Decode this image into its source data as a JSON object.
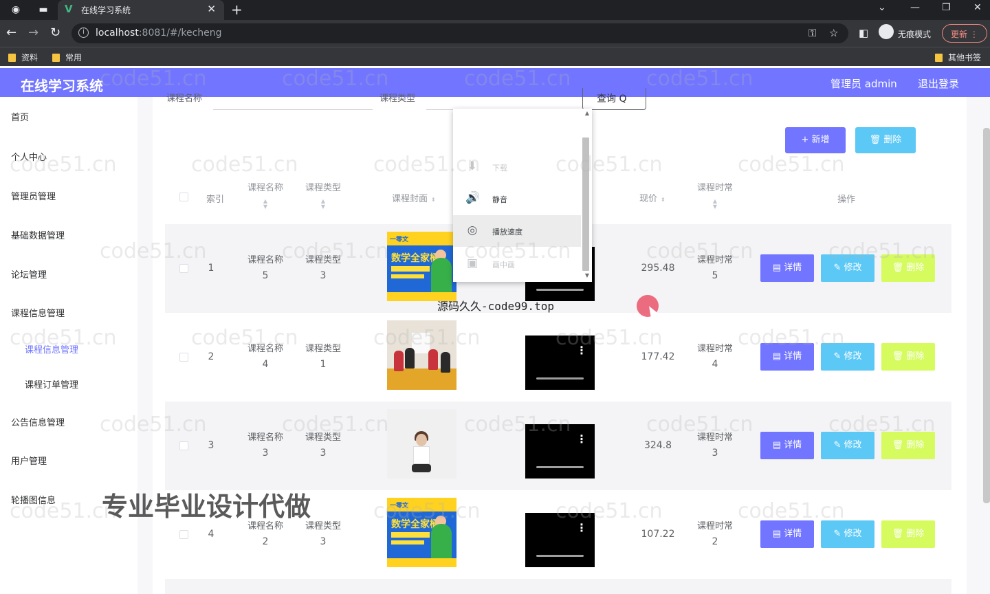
{
  "browser": {
    "tab_title": "在线学习系统",
    "url_host": "localhost",
    "url_rest": ":8081/#/kecheng",
    "incognito_label": "无痕模式",
    "update_label": "更新",
    "bookmarks": [
      "资料",
      "常用"
    ],
    "other_bookmarks": "其他书签"
  },
  "header": {
    "title": "在线学习系统",
    "user": "管理员 admin",
    "logout": "退出登录"
  },
  "sidebar": {
    "items": [
      {
        "label": "首页"
      },
      {
        "label": "个人中心"
      },
      {
        "label": "管理员管理"
      },
      {
        "label": "基础数据管理"
      },
      {
        "label": "论坛管理"
      },
      {
        "label": "课程信息管理"
      },
      {
        "label": "课程信息管理"
      },
      {
        "label": "课程订单管理"
      },
      {
        "label": "公告信息管理"
      },
      {
        "label": "用户管理"
      },
      {
        "label": "轮播图信息"
      }
    ]
  },
  "search": {
    "name_label": "课程名称",
    "type_label": "课程类型",
    "query_label": "查询 Q"
  },
  "toolbar": {
    "add_label": "+ 新增",
    "delete_label": "删除"
  },
  "table": {
    "headers": {
      "index": "索引",
      "name": "课程名称",
      "type": "课程类型",
      "cover": "课程封面",
      "price": "现价",
      "duration": "课程时常",
      "ops": "操作"
    },
    "rows": [
      {
        "index": "1",
        "name_label": "课程名称",
        "name_val": "5",
        "type_label": "课程类型",
        "type_val": "3",
        "price": "295.48",
        "dur_label": "课程时常",
        "dur_val": "5"
      },
      {
        "index": "2",
        "name_label": "课程名称",
        "name_val": "4",
        "type_label": "课程类型",
        "type_val": "1",
        "price": "177.42",
        "dur_label": "课程时常",
        "dur_val": "4"
      },
      {
        "index": "3",
        "name_label": "课程名称",
        "name_val": "3",
        "type_label": "课程类型",
        "type_val": "3",
        "price": "324.8",
        "dur_label": "课程时常",
        "dur_val": "3"
      },
      {
        "index": "4",
        "name_label": "课程名称",
        "name_val": "2",
        "type_label": "课程类型",
        "type_val": "3",
        "price": "107.22",
        "dur_label": "课程时常",
        "dur_val": "2"
      }
    ],
    "actions": {
      "detail": "详情",
      "edit": "修改",
      "delete": "删除"
    }
  },
  "cover_math": {
    "top": "一零文",
    "big": "数学全家桶"
  },
  "context_menu": {
    "items": [
      "下载",
      "静音",
      "播放速度",
      "画中画"
    ]
  },
  "overlays": {
    "source_text": "源码久久-code99.top",
    "promo": "专业毕业设计代做",
    "watermark": "code51.cn"
  }
}
